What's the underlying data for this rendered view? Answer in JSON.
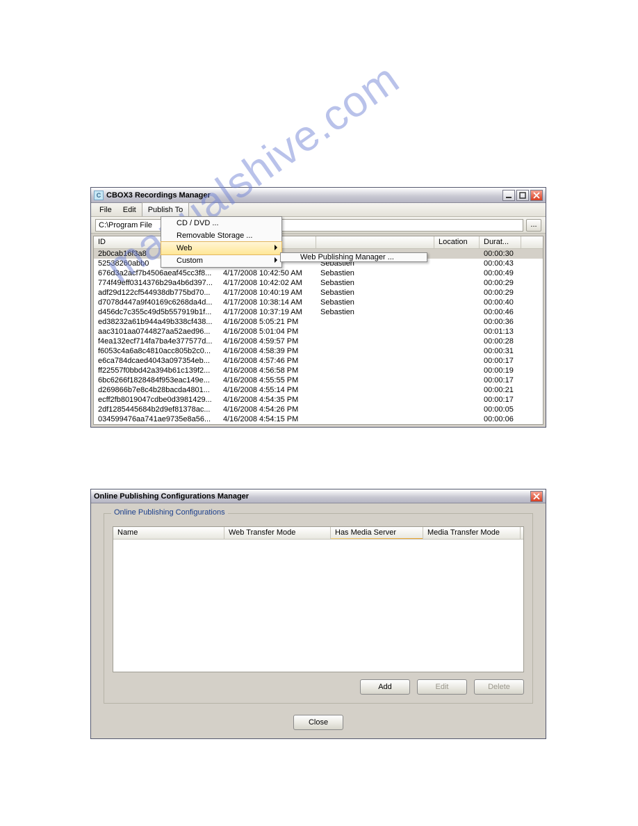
{
  "watermark": "manualshive.com",
  "window1": {
    "title": "CBOX3 Recordings Manager",
    "menu": [
      "File",
      "Edit",
      "Publish To"
    ],
    "publish_menu": {
      "cd": "CD / DVD ...",
      "removable": "Removable Storage ...",
      "web": "Web",
      "custom": "Custom"
    },
    "web_submenu": "Web Publishing Manager ...",
    "path_left": "C:\\Program File",
    "path_right": "\\",
    "browse": "...",
    "columns": {
      "id": "ID",
      "date": "",
      "author": "",
      "location": "Location",
      "duration": "Durat..."
    },
    "rows": [
      {
        "id": "2b0cab16f3a8",
        "date": "",
        "author": "",
        "dur": "00:00:30",
        "sel": true
      },
      {
        "id": "52538260abb0",
        "date": ":41 AM",
        "author": "Sebastien",
        "dur": "00:00:43"
      },
      {
        "id": "676d3a2acf7b4506aeaf45cc3f8...",
        "date": "4/17/2008 10:42:50 AM",
        "author": "Sebastien",
        "dur": "00:00:49"
      },
      {
        "id": "774f49eff0314376b29a4b6d397...",
        "date": "4/17/2008 10:42:02 AM",
        "author": "Sebastien",
        "dur": "00:00:29"
      },
      {
        "id": "adf29d122cf544938db775bd70...",
        "date": "4/17/2008 10:40:19 AM",
        "author": "Sebastien",
        "dur": "00:00:29"
      },
      {
        "id": "d7078d447a9f40169c6268da4d...",
        "date": "4/17/2008 10:38:14 AM",
        "author": "Sebastien",
        "dur": "00:00:40"
      },
      {
        "id": "d456dc7c355c49d5b557919b1f...",
        "date": "4/17/2008 10:37:19 AM",
        "author": "Sebastien",
        "dur": "00:00:46"
      },
      {
        "id": "ed38232a61b944a49b338cf438...",
        "date": "4/16/2008 5:05:21 PM",
        "author": "",
        "dur": "00:00:36"
      },
      {
        "id": "aac3101aa0744827aa52aed96...",
        "date": "4/16/2008 5:01:04 PM",
        "author": "",
        "dur": "00:01:13"
      },
      {
        "id": "f4ea132ecf714fa7ba4e377577d...",
        "date": "4/16/2008 4:59:57 PM",
        "author": "",
        "dur": "00:00:28"
      },
      {
        "id": "f6053c4a6a8c4810acc805b2c0...",
        "date": "4/16/2008 4:58:39 PM",
        "author": "",
        "dur": "00:00:31"
      },
      {
        "id": "e6ca784dcaed4043a097354eb...",
        "date": "4/16/2008 4:57:46 PM",
        "author": "",
        "dur": "00:00:17"
      },
      {
        "id": "ff22557f0bbd42a394b61c139f2...",
        "date": "4/16/2008 4:56:58 PM",
        "author": "",
        "dur": "00:00:19"
      },
      {
        "id": "6bc6266f1828484f953eac149e...",
        "date": "4/16/2008 4:55:55 PM",
        "author": "",
        "dur": "00:00:17"
      },
      {
        "id": "d269866b7e8c4b28bacda4801...",
        "date": "4/16/2008 4:55:14 PM",
        "author": "",
        "dur": "00:00:21"
      },
      {
        "id": "ecff2fb8019047cdbe0d3981429...",
        "date": "4/16/2008 4:54:35 PM",
        "author": "",
        "dur": "00:00:17"
      },
      {
        "id": "2df1285445684b2d9ef81378ac...",
        "date": "4/16/2008 4:54:26 PM",
        "author": "",
        "dur": "00:00:05"
      },
      {
        "id": "034599476aa741ae9735e8a56...",
        "date": "4/16/2008 4:54:15 PM",
        "author": "",
        "dur": "00:00:06"
      }
    ]
  },
  "window2": {
    "title": "Online Publishing Configurations Manager",
    "group_legend": "Online Publishing Configurations",
    "columns": {
      "name": "Name",
      "wtm": "Web Transfer Mode",
      "hms": "Has Media Server",
      "mtm": "Media Transfer Mode"
    },
    "buttons": {
      "add": "Add",
      "edit": "Edit",
      "delete": "Delete",
      "close": "Close"
    }
  }
}
